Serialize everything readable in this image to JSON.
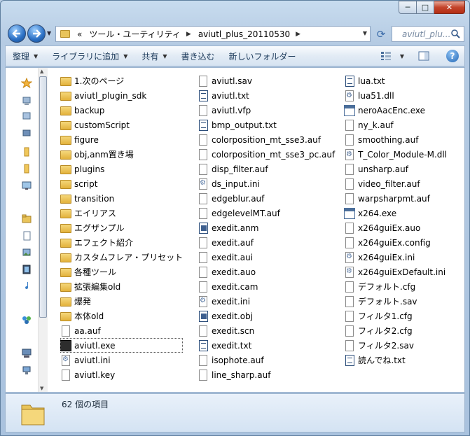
{
  "window": {
    "caption": {
      "minimize": "─",
      "maximize": "□",
      "close": "✕"
    }
  },
  "address": {
    "segments": [
      "«",
      "ツール・ユーティリティ",
      "aviutl_plus_20110530"
    ],
    "search_placeholder": "aviutl_plu..."
  },
  "toolbar": {
    "organize": "整理",
    "include_library": "ライブラリに追加",
    "share": "共有",
    "burn": "書き込む",
    "new_folder": "新しいフォルダー",
    "help": "?"
  },
  "columns": [
    [
      {
        "name": "1.次のページ",
        "icon": "folder"
      },
      {
        "name": "aviutl_plugin_sdk",
        "icon": "folder"
      },
      {
        "name": "backup",
        "icon": "folder"
      },
      {
        "name": "customScript",
        "icon": "folder"
      },
      {
        "name": "figure",
        "icon": "folder"
      },
      {
        "name": "obj,anm置き場",
        "icon": "folder"
      },
      {
        "name": "plugins",
        "icon": "folder"
      },
      {
        "name": "script",
        "icon": "folder"
      },
      {
        "name": "transition",
        "icon": "folder"
      },
      {
        "name": "エイリアス",
        "icon": "folder"
      },
      {
        "name": "エグザンプル",
        "icon": "folder"
      },
      {
        "name": "エフェクト紹介",
        "icon": "folder"
      },
      {
        "name": "カスタムフレア・プリセット",
        "icon": "folder"
      },
      {
        "name": "各種ツール",
        "icon": "folder"
      },
      {
        "name": "拡張編集old",
        "icon": "folder"
      },
      {
        "name": "爆発",
        "icon": "folder"
      },
      {
        "name": "本体old",
        "icon": "folder"
      },
      {
        "name": "aa.auf",
        "icon": "page"
      },
      {
        "name": "aviutl.exe",
        "icon": "exe",
        "selected": true
      },
      {
        "name": "aviutl.ini",
        "icon": "cfg"
      },
      {
        "name": "aviutl.key",
        "icon": "page"
      }
    ],
    [
      {
        "name": "aviutl.sav",
        "icon": "page"
      },
      {
        "name": "aviutl.txt",
        "icon": "txt"
      },
      {
        "name": "aviutl.vfp",
        "icon": "page"
      },
      {
        "name": "bmp_output.txt",
        "icon": "txt"
      },
      {
        "name": "colorposition_mt_sse3.auf",
        "icon": "page"
      },
      {
        "name": "colorposition_mt_sse3_pc.auf",
        "icon": "page"
      },
      {
        "name": "disp_filter.auf",
        "icon": "page"
      },
      {
        "name": "ds_input.ini",
        "icon": "cfg"
      },
      {
        "name": "edgeblur.auf",
        "icon": "page"
      },
      {
        "name": "edgelevelMT.auf",
        "icon": "page"
      },
      {
        "name": "exedit.anm",
        "icon": "anm"
      },
      {
        "name": "exedit.auf",
        "icon": "page"
      },
      {
        "name": "exedit.aui",
        "icon": "page"
      },
      {
        "name": "exedit.auo",
        "icon": "page"
      },
      {
        "name": "exedit.cam",
        "icon": "page"
      },
      {
        "name": "exedit.ini",
        "icon": "cfg"
      },
      {
        "name": "exedit.obj",
        "icon": "anm"
      },
      {
        "name": "exedit.scn",
        "icon": "page"
      },
      {
        "name": "exedit.txt",
        "icon": "txt"
      },
      {
        "name": "isophote.auf",
        "icon": "page"
      },
      {
        "name": "line_sharp.auf",
        "icon": "page"
      }
    ],
    [
      {
        "name": "lua.txt",
        "icon": "txt"
      },
      {
        "name": "lua51.dll",
        "icon": "dll"
      },
      {
        "name": "neroAacEnc.exe",
        "icon": "exe-win"
      },
      {
        "name": "ny_k.auf",
        "icon": "page"
      },
      {
        "name": "smoothing.auf",
        "icon": "page"
      },
      {
        "name": "T_Color_Module-M.dll",
        "icon": "dll"
      },
      {
        "name": "unsharp.auf",
        "icon": "page"
      },
      {
        "name": "video_filter.auf",
        "icon": "page"
      },
      {
        "name": "warpsharpmt.auf",
        "icon": "page"
      },
      {
        "name": "x264.exe",
        "icon": "exe-win"
      },
      {
        "name": "x264guiEx.auo",
        "icon": "page"
      },
      {
        "name": "x264guiEx.config",
        "icon": "page"
      },
      {
        "name": "x264guiEx.ini",
        "icon": "cfg"
      },
      {
        "name": "x264guiExDefault.ini",
        "icon": "cfg"
      },
      {
        "name": "デフォルト.cfg",
        "icon": "page"
      },
      {
        "name": "デフォルト.sav",
        "icon": "page"
      },
      {
        "name": "フィルタ1.cfg",
        "icon": "page"
      },
      {
        "name": "フィルタ2.cfg",
        "icon": "page"
      },
      {
        "name": "フィルタ2.sav",
        "icon": "page"
      },
      {
        "name": "読んでね.txt",
        "icon": "txt"
      }
    ]
  ],
  "status": {
    "item_count": "62 個の項目"
  }
}
